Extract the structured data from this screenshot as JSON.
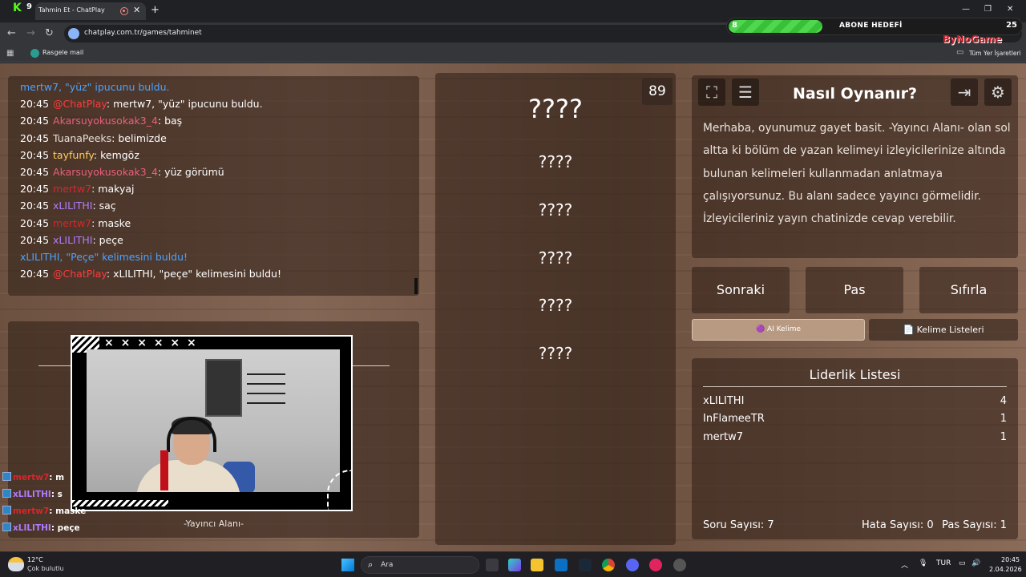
{
  "browser": {
    "tab_title": "Tahmin Et - ChatPlay",
    "url": "chatplay.com.tr/games/tahminet",
    "bookmark_label": "Rasgele mail",
    "bookmarks_right": "Tüm Yer İşaretleri",
    "kick_letter": "K",
    "kick_count": "9"
  },
  "goal": {
    "label": "ABONE HEDEFİ",
    "current": "8",
    "target": "25",
    "progress": 0.32,
    "sponsor": "ByNoGame"
  },
  "chat": {
    "lines": [
      {
        "time": "",
        "user": "mertw7",
        "user_color": "#4aa3ff",
        "text": ", \"yüz\" ipucunu buldu.",
        "text_color": "#4aa3ff",
        "highlight": "\"yüz\"",
        "highlight_color": "#ff3b3b"
      },
      {
        "time": "20:45",
        "user": "@ChatPlay",
        "user_color": "#ff3b3b",
        "text": ": mertw7, \"yüz\" ipucunu buldu.",
        "text_color": "#ffffff"
      },
      {
        "time": "20:45",
        "user": "Akarsuyokusokak3_4",
        "user_color": "#e8607a",
        "text": ": baş",
        "text_color": "#ffffff"
      },
      {
        "time": "20:45",
        "user": "TuanaPeeks",
        "user_color": "#e8e0d8",
        "text": ": belimizde",
        "text_color": "#ffffff"
      },
      {
        "time": "20:45",
        "user": "tayfunfy",
        "user_color": "#ffcf5a",
        "text": ": kemgöz",
        "text_color": "#ffffff"
      },
      {
        "time": "20:45",
        "user": "Akarsuyokusokak3_4",
        "user_color": "#e8607a",
        "text": ": yüz görümü",
        "text_color": "#ffffff"
      },
      {
        "time": "20:45",
        "user": "mertw7",
        "user_color": "#d8262c",
        "text": ": makyaj",
        "text_color": "#ffffff"
      },
      {
        "time": "20:45",
        "user": "xLILITHI",
        "user_color": "#b07cff",
        "text": ": saç",
        "text_color": "#ffffff"
      },
      {
        "time": "20:45",
        "user": "mertw7",
        "user_color": "#d8262c",
        "text": ": maske",
        "text_color": "#ffffff"
      },
      {
        "time": "20:45",
        "user": "xLILITHI",
        "user_color": "#b07cff",
        "text": ": peçe",
        "text_color": "#ffffff"
      },
      {
        "time": "",
        "user": "xLILITHI",
        "user_color": "#4aa3ff",
        "text": ", \"Peçe\" kelimesini buldu!",
        "text_color": "#4aa3ff",
        "highlight": "\"Peçe\"",
        "highlight_color": "#45d14a"
      },
      {
        "time": "20:45",
        "user": "@ChatPlay",
        "user_color": "#ff3b3b",
        "text": ": xLILITHI, \"peçe\" kelimesini buldu!",
        "text_color": "#ffffff"
      }
    ]
  },
  "stream_chat": [
    {
      "user": "mertw7",
      "user_color": "#d8262c",
      "text": ": m"
    },
    {
      "user": "xLILITHI",
      "user_color": "#b07cff",
      "text": ": s"
    },
    {
      "user": "mertw7",
      "user_color": "#d8262c",
      "text": ": maske"
    },
    {
      "user": "xLILITHI",
      "user_color": "#b07cff",
      "text": ": peçe"
    }
  ],
  "streamer_area_label": "-Yayıncı Alanı-",
  "cam_marks": "× × × × × ×",
  "words": {
    "timer": "89",
    "main": "????",
    "hints": [
      "????",
      "????",
      "????",
      "????",
      "????"
    ]
  },
  "howto": {
    "title": "Nasıl Oynanır?",
    "body": "Merhaba, oyunumuz gayet basit. -Yayıncı Alanı- olan sol altta ki bölüm de yazan kelimeyi izleyicilerinize altında bulunan kelimeleri kullanmadan anlatmaya çalışıyorsunuz. Bu alanı sadece yayıncı görmelidir. İzleyicileriniz yayın chatinizde cevap verebilir."
  },
  "controls": {
    "next": "Sonraki",
    "pass": "Pas",
    "reset": "Sıfırla",
    "ai_word": "🟣 AI Kelime",
    "word_lists": "📄 Kelime Listeleri"
  },
  "leaderboard": {
    "title": "Liderlik Listesi",
    "rows": [
      {
        "name": "xLILITHI",
        "score": "4"
      },
      {
        "name": "InFlameeTR",
        "score": "1"
      },
      {
        "name": "mertw7",
        "score": "1"
      }
    ]
  },
  "stats": {
    "questions": "Soru Sayısı: 7",
    "errors": "Hata Sayısı: 0",
    "passes": "Pas Sayısı: 1"
  },
  "taskbar": {
    "temperature": "12°C",
    "weather": "Çok bulutlu",
    "search_placeholder": "Ara",
    "language": "TUR",
    "time": "20:45",
    "date": "2.04.2026"
  }
}
